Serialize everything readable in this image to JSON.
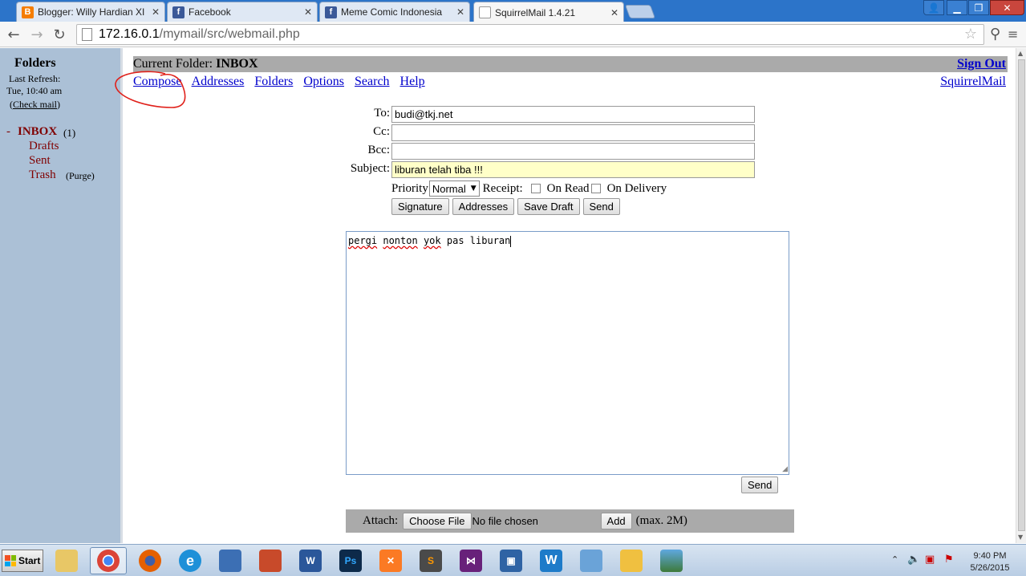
{
  "browser": {
    "tabs": [
      {
        "title": "Blogger: Willy Hardian XI TKJ",
        "icon": "blogger-icon",
        "color": "#f57d00",
        "glyph": "B"
      },
      {
        "title": "Facebook",
        "icon": "facebook-icon",
        "color": "#3b5998",
        "glyph": "f"
      },
      {
        "title": "Meme Comic Indonesia",
        "icon": "facebook-icon",
        "color": "#3b5998",
        "glyph": "f"
      },
      {
        "title": "SquirrelMail 1.4.21",
        "icon": "page-icon",
        "color": "#ffffff",
        "glyph": ""
      }
    ],
    "url_host": "172.16.0.1",
    "url_path": "/mymail/src/webmail.php"
  },
  "sidebar": {
    "title": "Folders",
    "last_refresh_label": "Last Refresh:",
    "last_refresh_time": "Tue, 10:40 am",
    "check_mail": "Check mail",
    "folders": {
      "inbox": "INBOX",
      "inbox_count": "(1)",
      "drafts": "Drafts",
      "sent": "Sent",
      "trash": "Trash",
      "purge": "Purge"
    }
  },
  "header": {
    "current_folder_label": "Current Folder:",
    "current_folder": "INBOX",
    "sign_out": "Sign Out",
    "menu": [
      "Compose",
      "Addresses",
      "Folders",
      "Options",
      "Search",
      "Help"
    ],
    "brand_link": "SquirrelMail"
  },
  "compose": {
    "to_label": "To:",
    "to_value": "budi@tkj.net",
    "cc_label": "Cc:",
    "cc_value": "",
    "bcc_label": "Bcc:",
    "bcc_value": "",
    "subject_label": "Subject:",
    "subject_value": "liburan telah tiba !!!",
    "priority_label": "Priority",
    "priority_value": "Normal",
    "receipt_label": "Receipt:",
    "on_read": "On Read",
    "on_delivery": "On Delivery",
    "buttons": {
      "signature": "Signature",
      "addresses": "Addresses",
      "save_draft": "Save Draft",
      "send": "Send"
    },
    "body_words": [
      "pergi",
      "nonton",
      "yok",
      "pas",
      "liburan"
    ],
    "send_bottom": "Send",
    "attach_label": "Attach:",
    "choose_file": "Choose File",
    "no_file": "No file chosen",
    "add": "Add",
    "max_size": "(max. 2M)"
  },
  "taskbar": {
    "start": "Start",
    "time": "9:40 PM",
    "date": "5/26/2015"
  }
}
